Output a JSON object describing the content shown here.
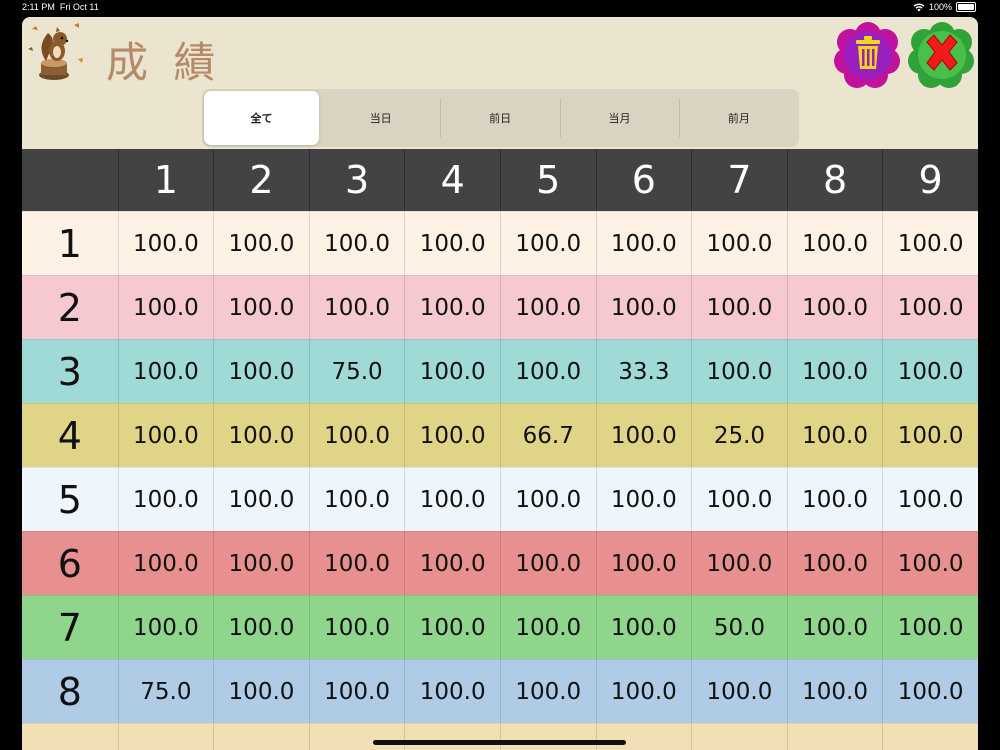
{
  "status_bar": {
    "time": "2:11 PM",
    "date": "Fri Oct 11",
    "battery": "100%"
  },
  "header": {
    "title": "成 績"
  },
  "segments": [
    {
      "label": "全て",
      "active": true
    },
    {
      "label": "当日",
      "active": false
    },
    {
      "label": "前日",
      "active": false
    },
    {
      "label": "当月",
      "active": false
    },
    {
      "label": "前月",
      "active": false
    }
  ],
  "table": {
    "columns": [
      "1",
      "2",
      "3",
      "4",
      "5",
      "6",
      "7",
      "8",
      "9"
    ],
    "rows": [
      {
        "label": "1",
        "color": "#fdf2e3",
        "values": [
          "100.0",
          "100.0",
          "100.0",
          "100.0",
          "100.0",
          "100.0",
          "100.0",
          "100.0",
          "100.0"
        ]
      },
      {
        "label": "2",
        "color": "#f6c8d0",
        "values": [
          "100.0",
          "100.0",
          "100.0",
          "100.0",
          "100.0",
          "100.0",
          "100.0",
          "100.0",
          "100.0"
        ]
      },
      {
        "label": "3",
        "color": "#9fdad6",
        "values": [
          "100.0",
          "100.0",
          "75.0",
          "100.0",
          "100.0",
          "33.3",
          "100.0",
          "100.0",
          "100.0"
        ]
      },
      {
        "label": "4",
        "color": "#e0d486",
        "values": [
          "100.0",
          "100.0",
          "100.0",
          "100.0",
          "66.7",
          "100.0",
          "25.0",
          "100.0",
          "100.0"
        ]
      },
      {
        "label": "5",
        "color": "#eef5fb",
        "values": [
          "100.0",
          "100.0",
          "100.0",
          "100.0",
          "100.0",
          "100.0",
          "100.0",
          "100.0",
          "100.0"
        ]
      },
      {
        "label": "6",
        "color": "#e89090",
        "values": [
          "100.0",
          "100.0",
          "100.0",
          "100.0",
          "100.0",
          "100.0",
          "100.0",
          "100.0",
          "100.0"
        ]
      },
      {
        "label": "7",
        "color": "#8fd58c",
        "values": [
          "100.0",
          "100.0",
          "100.0",
          "100.0",
          "100.0",
          "100.0",
          "50.0",
          "100.0",
          "100.0"
        ]
      },
      {
        "label": "8",
        "color": "#b0cbe6",
        "values": [
          "75.0",
          "100.0",
          "100.0",
          "100.0",
          "100.0",
          "100.0",
          "100.0",
          "100.0",
          "100.0"
        ]
      },
      {
        "label": "",
        "color": "#f2dfb6",
        "values": [
          "",
          "",
          "",
          "",
          "",
          "",
          "",
          "",
          ""
        ]
      }
    ]
  },
  "icons": {
    "trash": "trash-icon",
    "close": "close-icon",
    "logo": "squirrel-logo-icon"
  }
}
